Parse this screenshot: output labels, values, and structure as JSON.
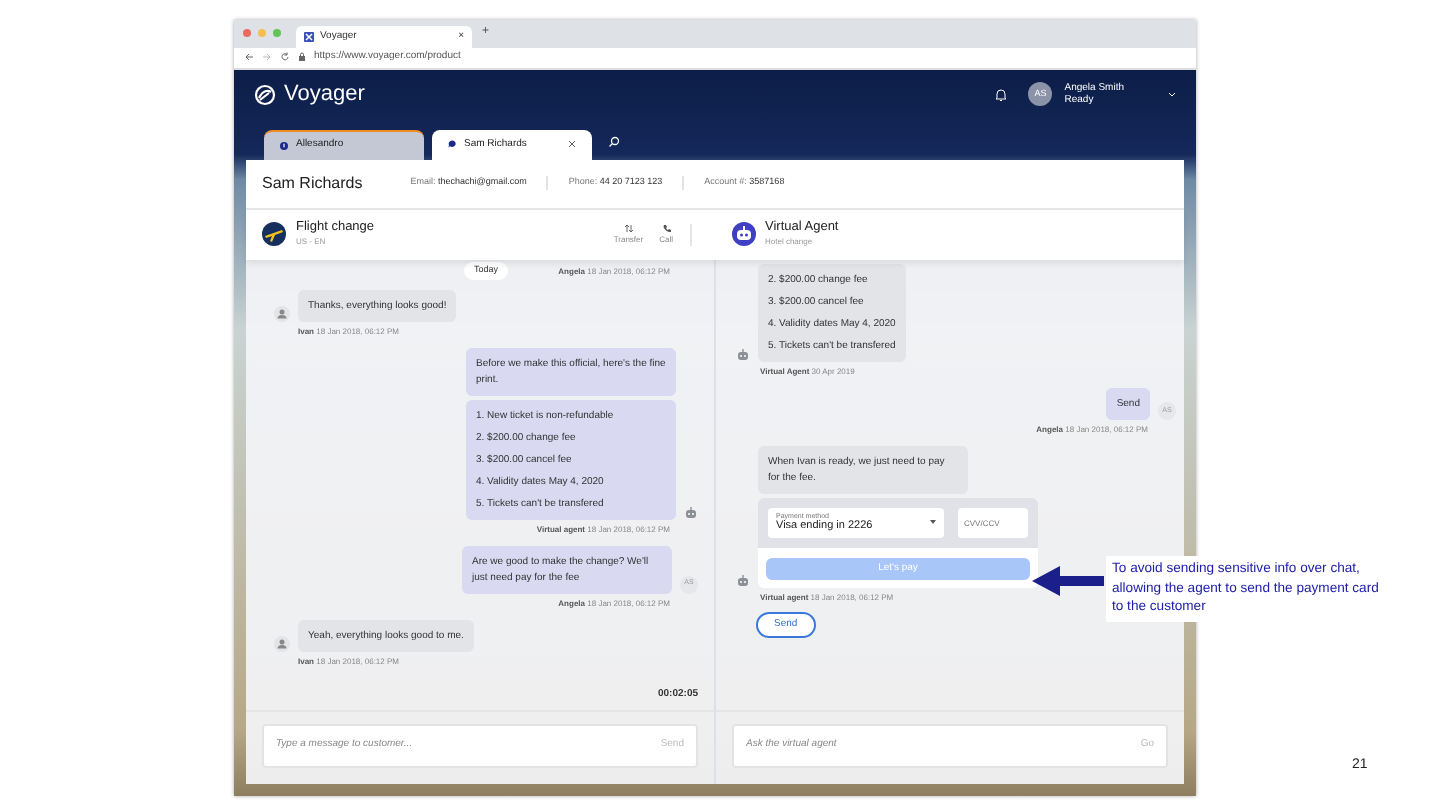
{
  "browser": {
    "tab_title": "Voyager",
    "tab_close": "×",
    "new_tab": "+",
    "url": "https://www.voyager.com/product"
  },
  "app": {
    "logo": "Voyager",
    "user": {
      "initials": "AS",
      "name": "Angela Smith",
      "status": "Ready"
    }
  },
  "conversation_tabs": [
    {
      "label": "Allesandro",
      "selected": false,
      "kind": "alert"
    },
    {
      "label": "Sam Richards",
      "selected": true,
      "kind": "chat"
    }
  ],
  "customer": {
    "name": "Sam Richards",
    "fields": [
      {
        "label": "Email:",
        "value": "thechachi@gmail.com"
      },
      {
        "label": "Phone:",
        "value": "44 20 7123 123"
      },
      {
        "label": "Account #:",
        "value": "3587168"
      }
    ]
  },
  "customer_chat": {
    "title": "Flight change",
    "subtitle": "US - EN",
    "actions": [
      {
        "label": "Transfer",
        "kind": "transfer"
      },
      {
        "label": "Call",
        "kind": "call"
      }
    ],
    "top": {
      "day": "Today",
      "sender": "Angela",
      "time": "18 Jan 2018, 06:12 PM"
    },
    "messages": [
      {
        "kind": "received",
        "sender": "Ivan",
        "time": "18 Jan 2018, 06:12 PM",
        "avatar": {
          "kind": "user"
        },
        "bubbles": [
          {
            "kind": "text",
            "text": "Thanks, everything looks good!"
          }
        ]
      },
      {
        "kind": "sent",
        "sender": "Virtual agent",
        "time": "18 Jan 2018, 06:12 PM",
        "avatar": {
          "kind": "bot"
        },
        "bubbles": [
          {
            "kind": "text",
            "text": "Before we make this official, here's the fine print."
          },
          {
            "kind": "list",
            "items": [
              "1. New ticket is non-refundable",
              "2. $200.00 change fee",
              "3. $200.00 cancel fee",
              "4. Validity dates May 4, 2020",
              "5. Tickets can't be transfered"
            ]
          }
        ]
      },
      {
        "kind": "sent",
        "sender": "Angela",
        "time": "18 Jan 2018, 06:12 PM",
        "avatar": {
          "kind": "initials",
          "text": "AS"
        },
        "bubbles": [
          {
            "kind": "text",
            "text": "Are we good to make the change? We'll just need pay for the fee"
          }
        ]
      },
      {
        "kind": "received",
        "sender": "Ivan",
        "time": "18 Jan 2018, 06:12 PM",
        "avatar": {
          "kind": "user"
        },
        "bubbles": [
          {
            "kind": "text",
            "text": "Yeah, everything looks good to me."
          }
        ]
      }
    ],
    "timer": "00:02:05",
    "input": {
      "placeholder": "Type a message to customer...",
      "button": "Send"
    }
  },
  "agent_chat": {
    "title": "Virtual Agent",
    "subtitle": "Hotel change",
    "messages": [
      {
        "kind": "received",
        "sender": "Virtual Agent",
        "time": "30 Apr 2019",
        "avatar": {
          "kind": "bot"
        },
        "bubbles": [
          {
            "kind": "list",
            "items": [
              "2. $200.00 change fee",
              "3. $200.00 cancel fee",
              "4. Validity dates May 4, 2020",
              "5. Tickets can't be transfered"
            ]
          }
        ]
      },
      {
        "kind": "sent",
        "sender": "Angela",
        "time": "18 Jan 2018, 06:12 PM",
        "avatar": {
          "kind": "initials",
          "text": "AS"
        },
        "bubbles": [
          {
            "kind": "text",
            "text": "Send"
          }
        ]
      },
      {
        "kind": "received",
        "sender": "Virtual agent",
        "time": "18 Jan 2018, 06:12 PM",
        "avatar": {
          "kind": "bot"
        },
        "bubbles": [
          {
            "kind": "text",
            "text": "When Ivan is ready, we just need to pay for the fee."
          },
          {
            "kind": "payment",
            "method_label": "Payment method",
            "method_value": "Visa ending in 2226",
            "cvv_placeholder": "CVV/CCV",
            "button": "Let's pay",
            "button_disabled": true
          }
        ],
        "action": "Send"
      }
    ],
    "input": {
      "placeholder": "Ask the virtual agent",
      "button": "Go"
    }
  },
  "callout": {
    "text": "To avoid sending sensitive info over chat, allowing the agent to send the payment card to the customer"
  },
  "page_number": "21"
}
